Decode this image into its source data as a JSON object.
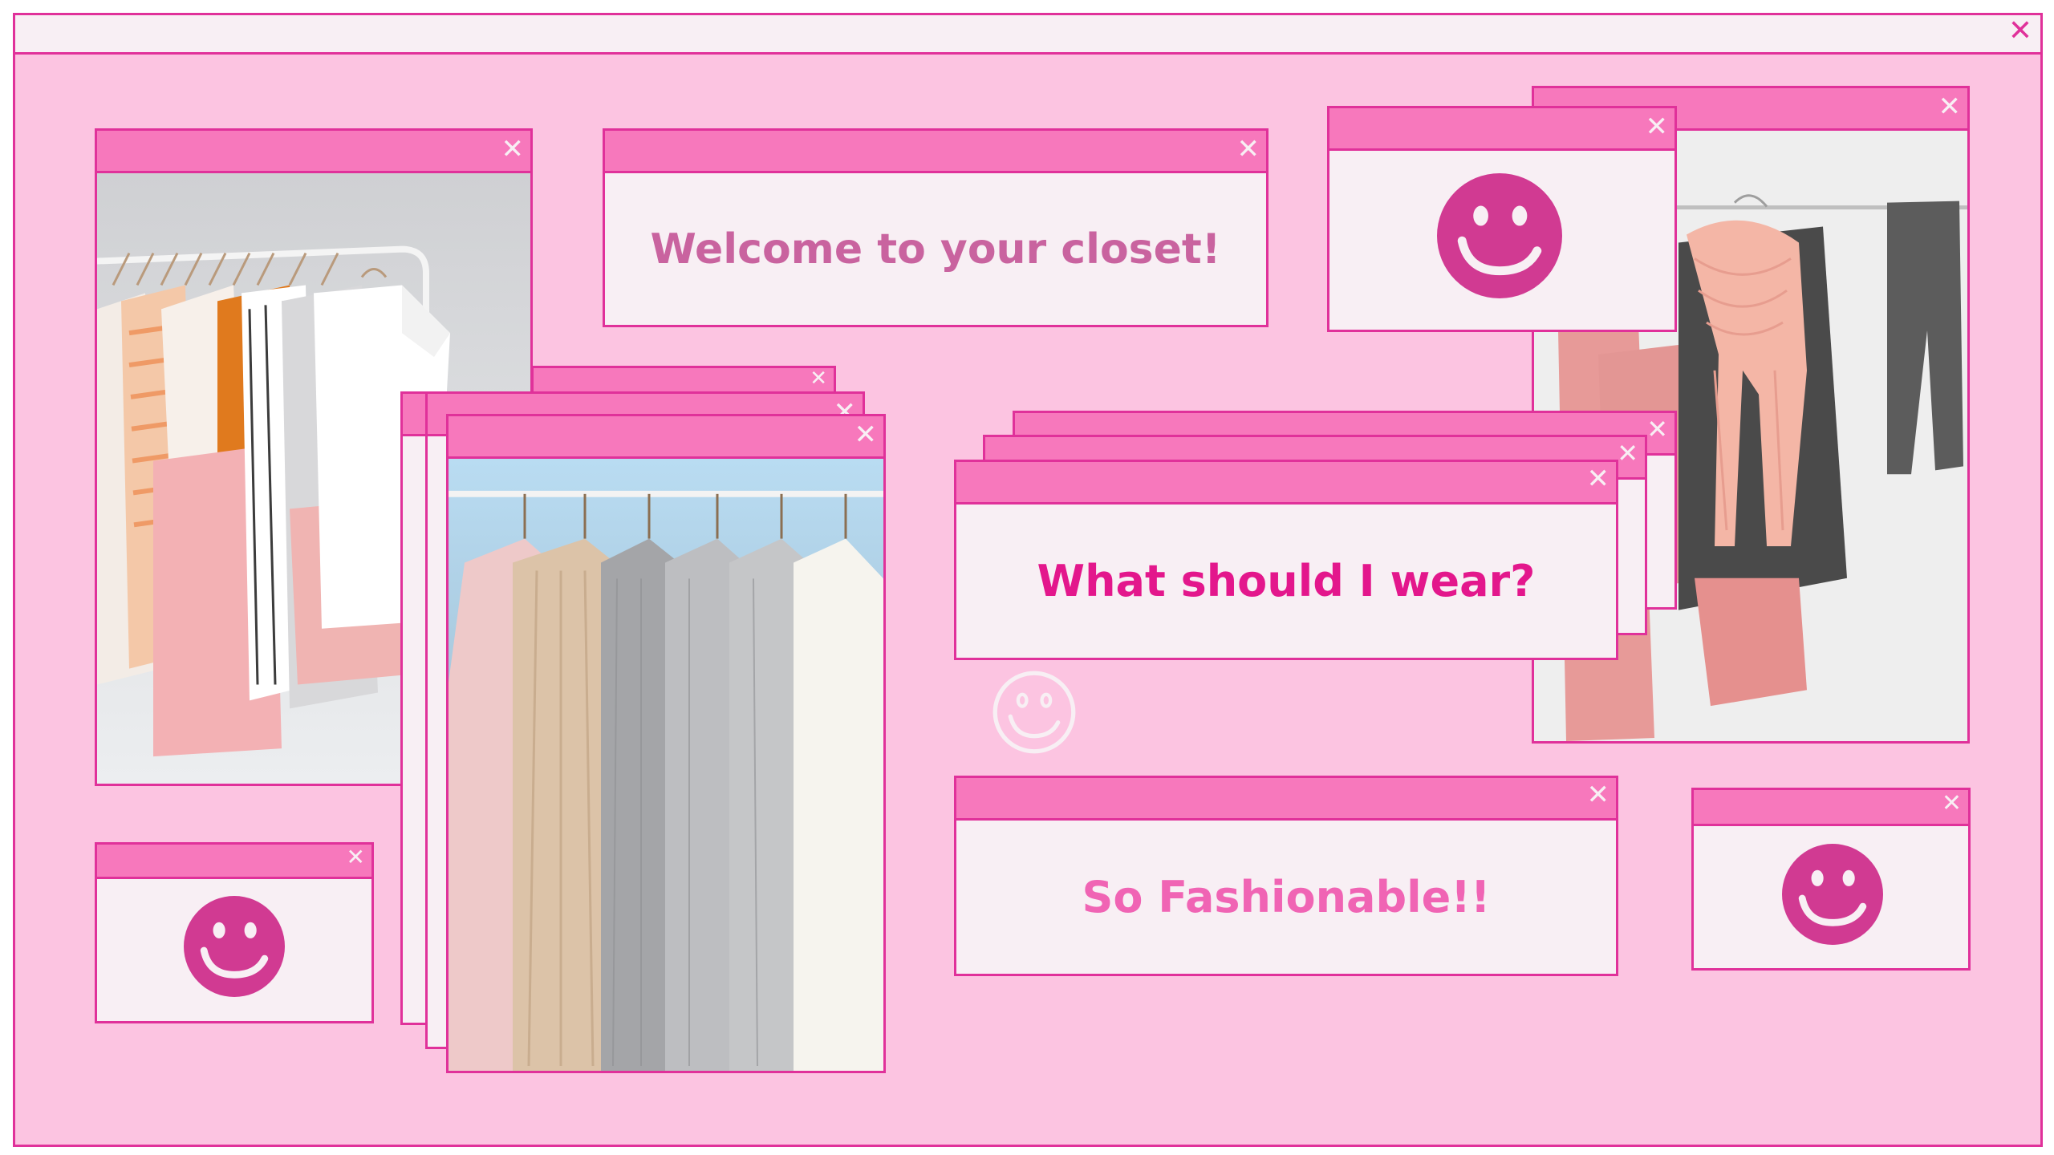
{
  "colors": {
    "desktop_bg": "#fcc4e1",
    "window_bg": "#f8eff4",
    "titlebar": "#f778bc",
    "border": "#e0319a",
    "face": "#d13a92",
    "welcome_text": "#c9639f",
    "wear_text": "#e3178c",
    "fashion_text": "#f064b4"
  },
  "screen": {
    "close_glyph": "✕"
  },
  "windows": {
    "welcome": {
      "text": "Welcome to your closet!"
    },
    "wear": {
      "text": "What should I wear?"
    },
    "fashion": {
      "text": "So Fashionable!!"
    }
  },
  "icons": {
    "close": "close-icon",
    "smiley": "smiley-face-icon",
    "smiley_outline": "smiley-outline-icon"
  }
}
